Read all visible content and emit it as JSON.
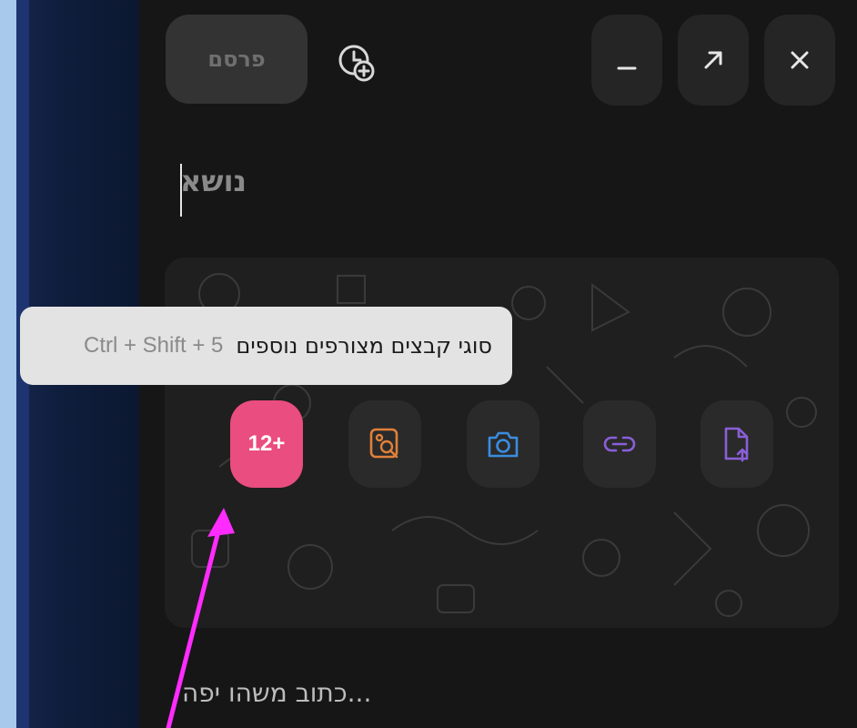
{
  "header": {
    "publish_label": "פרסם",
    "schedule_icon": "clock-plus-icon",
    "minimize_icon": "minimize-icon",
    "expand_icon": "expand-arrow-icon",
    "close_icon": "close-icon"
  },
  "editor": {
    "subject_placeholder": "נושא",
    "body_placeholder": "...כתוב משהו יפה"
  },
  "attachments": {
    "more_types_label": "12+",
    "buttons": [
      {
        "name": "more-types",
        "color": "#ea4d7f"
      },
      {
        "name": "gallery",
        "icon": "image-search-icon",
        "color": "#e0803a"
      },
      {
        "name": "camera",
        "icon": "camera-icon",
        "color": "#3b8de0"
      },
      {
        "name": "link",
        "icon": "link-icon",
        "color": "#8a5fd9"
      },
      {
        "name": "file",
        "icon": "file-upload-icon",
        "color": "#8a5fd9"
      }
    ]
  },
  "tooltip": {
    "text": "סוגי קבצים מצורפים נוספים",
    "shortcut": "Ctrl + Shift + 5"
  },
  "colors": {
    "accent_pink": "#ea4d7f",
    "annotation_arrow": "#ff2bff",
    "panel_bg": "#161616"
  }
}
